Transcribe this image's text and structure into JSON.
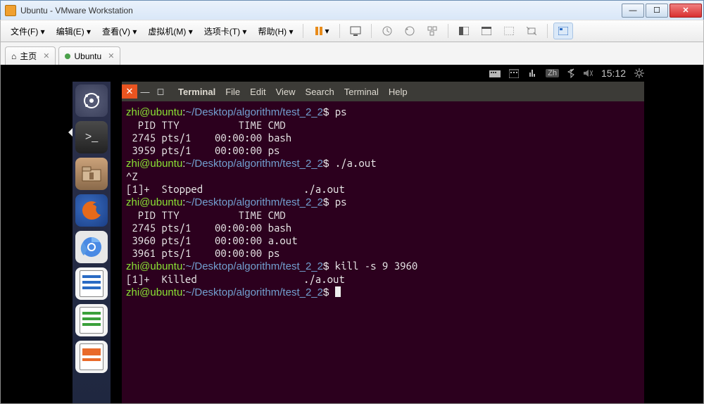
{
  "window": {
    "title": "Ubuntu - VMware Workstation"
  },
  "menubar": {
    "file": "文件(F)",
    "edit": "编辑(E)",
    "view": "查看(V)",
    "vm": "虚拟机(M)",
    "tabs": "选项卡(T)",
    "help": "帮助(H)"
  },
  "tabs": {
    "home": "主页",
    "vm": "Ubuntu"
  },
  "ubuntu": {
    "ime": "Zh",
    "time": "15:12"
  },
  "terminal": {
    "menu": {
      "app": "Terminal",
      "file": "File",
      "edit": "Edit",
      "view": "View",
      "search": "Search",
      "terminal": "Terminal",
      "help": "Help"
    },
    "prompt_user": "zhi@ubuntu",
    "prompt_path": "~/Desktop/algorithm/test_2_2",
    "lines": [
      {
        "type": "cmd",
        "text": "ps"
      },
      {
        "type": "out",
        "text": "  PID TTY          TIME CMD"
      },
      {
        "type": "out",
        "text": " 2745 pts/1    00:00:00 bash"
      },
      {
        "type": "out",
        "text": " 3959 pts/1    00:00:00 ps"
      },
      {
        "type": "cmd",
        "text": "./a.out"
      },
      {
        "type": "out",
        "text": "^Z"
      },
      {
        "type": "out",
        "text": "[1]+  Stopped                 ./a.out"
      },
      {
        "type": "cmd",
        "text": "ps"
      },
      {
        "type": "out",
        "text": "  PID TTY          TIME CMD"
      },
      {
        "type": "out",
        "text": " 2745 pts/1    00:00:00 bash"
      },
      {
        "type": "out",
        "text": " 3960 pts/1    00:00:00 a.out"
      },
      {
        "type": "out",
        "text": " 3961 pts/1    00:00:00 ps"
      },
      {
        "type": "cmd",
        "text": "kill -s 9 3960"
      },
      {
        "type": "out",
        "text": "[1]+  Killed                  ./a.out"
      },
      {
        "type": "cmd",
        "text": ""
      }
    ]
  }
}
